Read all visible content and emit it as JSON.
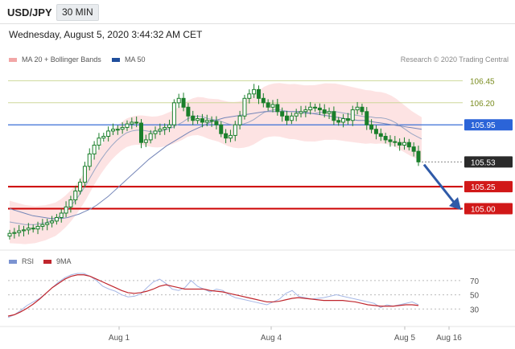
{
  "header": {
    "symbol": "USD/JPY",
    "timeframe": "30 MIN"
  },
  "datetime": "Wednesday, August 5, 2020 3:44:32 AM CET",
  "legend": {
    "items": [
      {
        "label": "MA 20 + Bollinger Bands",
        "color": "#f2a6a6"
      },
      {
        "label": "MA 50",
        "color": "#1f4e9c"
      }
    ],
    "credit": "Research © 2020 Trading Central"
  },
  "rsi_legend": {
    "items": [
      {
        "label": "RSI",
        "color": "#7b93d1"
      },
      {
        "label": "9MA",
        "color": "#c0262d"
      }
    ]
  },
  "colors": {
    "candle": "#1a7f2b",
    "bb_fill": "#fde2e2",
    "ma20": "#f2a6a6",
    "ma50": "#1f4e9c",
    "support": "#cc0000",
    "resistance": "#cdd89a",
    "pivot": "#3a6fd6",
    "arrow": "#2f5aa8",
    "rsi": "#a6b8e6",
    "rsi_ma": "#c0262d"
  },
  "chart_data": [
    {
      "type": "candlestick",
      "title": "USD/JPY",
      "ylim": [
        104.54,
        106.59
      ],
      "x_ticks": [
        "Aug 1",
        "Aug 4",
        "Aug 5",
        "Aug 16"
      ],
      "levels": [
        {
          "value": 106.45,
          "label": "106.45",
          "kind": "resistance"
        },
        {
          "value": 106.2,
          "label": "106.20",
          "kind": "resistance"
        },
        {
          "value": 105.95,
          "label": "105.95",
          "kind": "pivot"
        },
        {
          "value": 105.53,
          "label": "105.53",
          "kind": "last"
        },
        {
          "value": 105.25,
          "label": "105.25",
          "kind": "support"
        },
        {
          "value": 105.0,
          "label": "105.00",
          "kind": "support"
        }
      ],
      "close": [
        104.72,
        104.73,
        104.75,
        104.76,
        104.78,
        104.77,
        104.8,
        104.82,
        104.84,
        104.86,
        104.9,
        104.95,
        105.02,
        105.1,
        105.2,
        105.3,
        105.48,
        105.62,
        105.72,
        105.8,
        105.82,
        105.88,
        105.9,
        105.9,
        105.92,
        105.96,
        105.98,
        105.97,
        105.75,
        105.78,
        105.85,
        105.88,
        105.9,
        105.92,
        105.95,
        106.2,
        106.25,
        106.15,
        106.05,
        106.0,
        106.02,
        105.98,
        106.0,
        105.99,
        105.95,
        105.85,
        105.8,
        105.83,
        105.95,
        106.05,
        106.25,
        106.3,
        106.35,
        106.25,
        106.2,
        106.15,
        106.18,
        106.1,
        106.05,
        106.0,
        106.05,
        106.08,
        106.1,
        106.12,
        106.15,
        106.14,
        106.12,
        106.08,
        106.1,
        106.0,
        105.98,
        106.02,
        106.0,
        106.12,
        106.15,
        106.1,
        105.95,
        105.9,
        105.85,
        105.82,
        105.78,
        105.76,
        105.75,
        105.72,
        105.75,
        105.7,
        105.65,
        105.53
      ],
      "ma20": [
        104.85,
        104.84,
        104.83,
        104.82,
        104.82,
        104.82,
        104.83,
        104.84,
        104.86,
        104.88,
        104.92,
        104.97,
        105.03,
        105.1,
        105.18,
        105.27,
        105.37,
        105.47,
        105.56,
        105.64,
        105.71,
        105.77,
        105.82,
        105.86,
        105.88,
        105.89,
        105.89,
        105.88,
        105.87,
        105.87,
        105.88,
        105.9,
        105.92,
        105.95,
        105.98,
        106.02,
        106.04,
        106.05,
        106.04,
        106.02,
        106.01,
        106.0,
        105.98,
        105.96,
        105.95,
        105.95,
        105.96,
        105.98,
        106.01,
        106.05,
        106.09,
        106.11,
        106.12,
        106.12,
        106.11,
        106.1,
        106.1,
        106.09,
        106.08,
        106.08,
        106.08,
        106.09,
        106.1,
        106.1,
        106.1,
        106.09,
        106.08,
        106.07,
        106.06,
        106.05,
        106.04,
        106.04,
        106.03,
        106.03,
        106.02,
        106.0,
        105.97,
        105.93,
        105.89,
        105.85,
        105.82,
        105.79
      ],
      "ma50": [
        105.0,
        104.98,
        104.96,
        104.94,
        104.92,
        104.91,
        104.9,
        104.89,
        104.89,
        104.89,
        104.9,
        104.92,
        104.94,
        104.97,
        105.0,
        105.04,
        105.09,
        105.14,
        105.2,
        105.26,
        105.32,
        105.38,
        105.44,
        105.5,
        105.56,
        105.61,
        105.66,
        105.71,
        105.75,
        105.79,
        105.83,
        105.87,
        105.9,
        105.93,
        105.96,
        105.99,
        106.01,
        106.03,
        106.04,
        106.05,
        106.06,
        106.07,
        106.08,
        106.09,
        106.1,
        106.1,
        106.1,
        106.1,
        106.1,
        106.1,
        106.1,
        106.09,
        106.08,
        106.07,
        106.06,
        106.05,
        106.04,
        106.03,
        106.02,
        106.01,
        106.0,
        106.0,
        105.99,
        105.98,
        105.97,
        105.96,
        105.95,
        105.94,
        105.93,
        105.92,
        105.91,
        105.9
      ]
    },
    {
      "type": "line",
      "title": "RSI",
      "ylim": [
        0,
        100
      ],
      "y_ticks": [
        70,
        50,
        30
      ],
      "series": [
        {
          "name": "RSI",
          "values": [
            18,
            22,
            28,
            35,
            40,
            45,
            52,
            60,
            68,
            74,
            78,
            80,
            80,
            76,
            70,
            62,
            58,
            55,
            50,
            47,
            48,
            51,
            60,
            68,
            72,
            66,
            58,
            56,
            60,
            70,
            62,
            58,
            54,
            58,
            56,
            50,
            46,
            44,
            42,
            40,
            38,
            36,
            40,
            44,
            52,
            56,
            48,
            46,
            44,
            45,
            46,
            48,
            50,
            48,
            46,
            44,
            42,
            40,
            38,
            32,
            36,
            34,
            36,
            38,
            40,
            36
          ]
        },
        {
          "name": "9MA",
          "values": [
            20,
            22,
            26,
            31,
            37,
            44,
            52,
            60,
            66,
            72,
            76,
            78,
            78,
            76,
            72,
            68,
            64,
            60,
            56,
            53,
            52,
            53,
            55,
            58,
            62,
            64,
            62,
            60,
            58,
            58,
            58,
            58,
            56,
            55,
            54,
            52,
            50,
            48,
            46,
            44,
            42,
            40,
            40,
            41,
            43,
            45,
            46,
            45,
            44,
            43,
            42,
            42,
            42,
            42,
            41,
            40,
            38,
            36,
            35,
            34,
            34,
            34,
            35,
            36,
            36,
            35
          ]
        }
      ]
    }
  ]
}
